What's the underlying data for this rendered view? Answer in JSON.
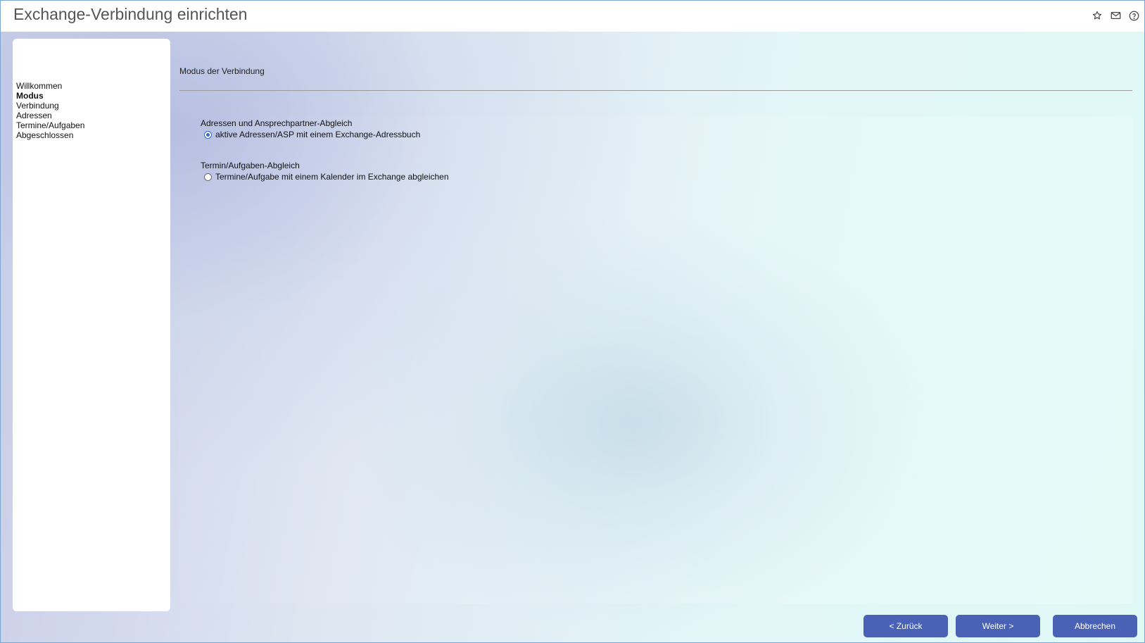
{
  "window": {
    "title": "Exchange-Verbindung einrichten",
    "icons": [
      "star-icon",
      "mail-icon",
      "help-icon"
    ]
  },
  "steps": [
    {
      "label": "Willkommen",
      "active": false
    },
    {
      "label": "Modus",
      "active": true
    },
    {
      "label": "Verbindung",
      "active": false
    },
    {
      "label": "Adressen",
      "active": false
    },
    {
      "label": "Termine/Aufgaben",
      "active": false
    },
    {
      "label": "Abgeschlossen",
      "active": false
    }
  ],
  "main": {
    "section_title": "Modus der Verbindung",
    "groups": [
      {
        "label": "Adressen und Ansprechpartner-Abgleich",
        "option_label": "aktive Adressen/ASP mit einem Exchange-Adressbuch",
        "checked": true
      },
      {
        "label": "Termin/Aufgaben-Abgleich",
        "option_label": "Termine/Aufgabe mit einem Kalender im Exchange abgleichen",
        "checked": false
      }
    ]
  },
  "footer": {
    "back_label": "< Zurück",
    "next_label": "Weiter >",
    "cancel_label": "Abbrechen"
  },
  "colors": {
    "button_bg": "#4a62b5",
    "radio_checked": "#2f6fc0",
    "border": "#7aa6cf"
  }
}
